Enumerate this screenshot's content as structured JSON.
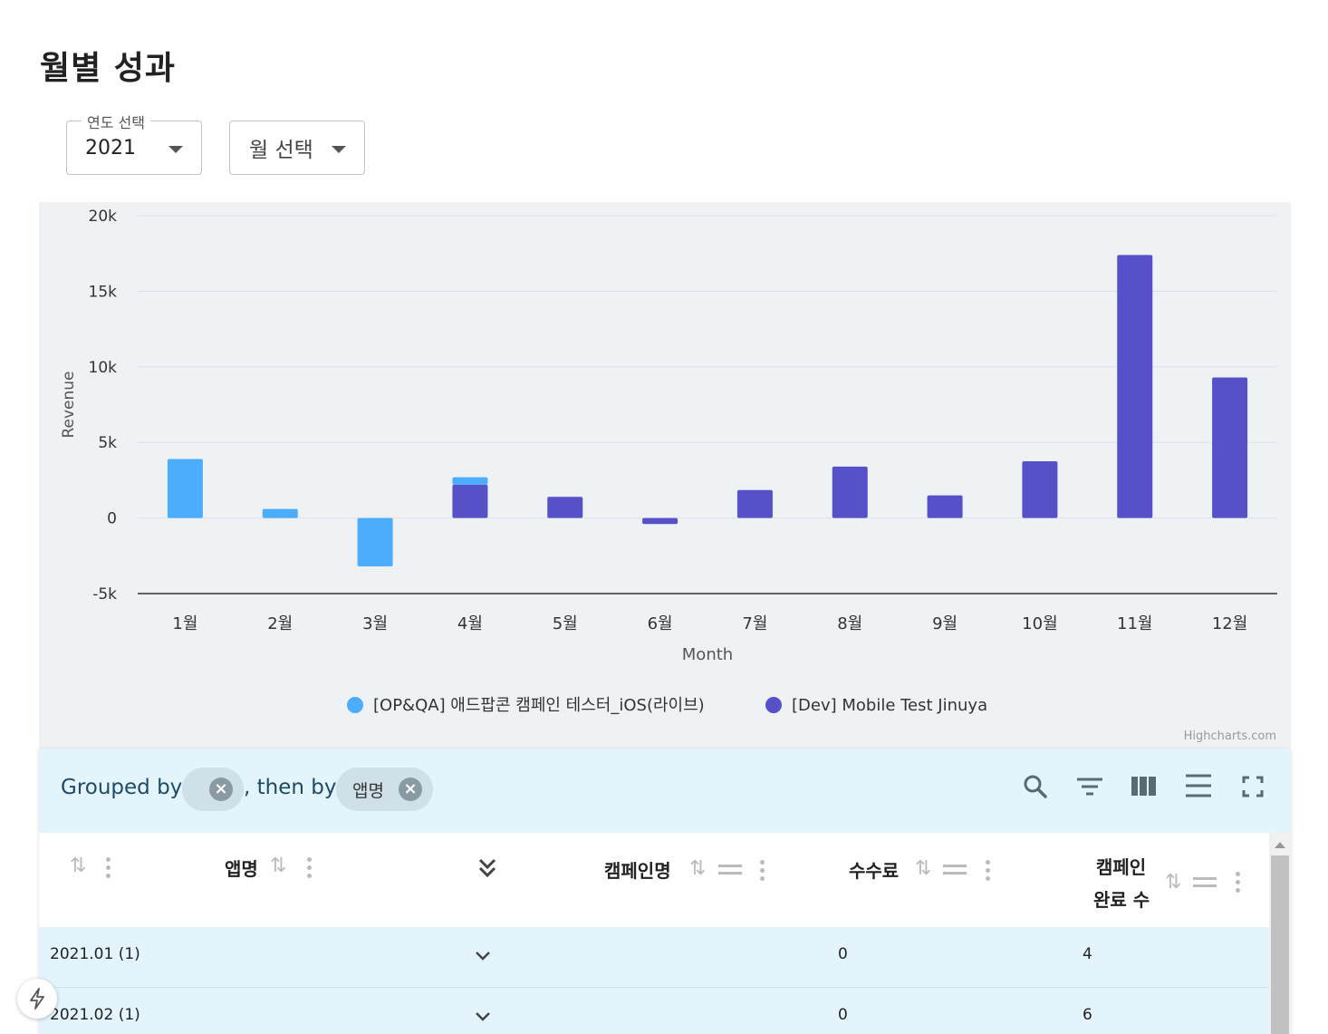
{
  "page": {
    "title": "월별 성과"
  },
  "filters": {
    "year": {
      "legend": "연도 선택",
      "value": "2021"
    },
    "month": {
      "value": "월 선택"
    }
  },
  "chart_data": {
    "type": "bar",
    "stacked": true,
    "categories": [
      "1월",
      "2월",
      "3월",
      "4월",
      "5월",
      "6월",
      "7월",
      "8월",
      "9월",
      "10월",
      "11월",
      "12월"
    ],
    "series": [
      {
        "name": "[OP&QA] 애드팝콘 캠페인 테스터_iOS(라이브)",
        "color": "#4badfc",
        "values": [
          3900,
          600,
          -3200,
          500,
          0,
          0,
          0,
          0,
          0,
          0,
          0,
          0
        ]
      },
      {
        "name": "[Dev] Mobile Test Jinuya",
        "color": "#5651c9",
        "values": [
          0,
          0,
          0,
          2200,
          1400,
          -400,
          1850,
          3400,
          1500,
          3750,
          17400,
          9300
        ]
      }
    ],
    "xlabel": "Month",
    "ylabel": "Revenue",
    "ylim": [
      -5000,
      20000
    ],
    "yticks": [
      "-5k",
      "0",
      "5k",
      "10k",
      "15k",
      "20k"
    ],
    "grid": true,
    "legend": "bottom-center",
    "credits": "Highcharts.com"
  },
  "grid": {
    "toolbar": {
      "grouped_by_label": "Grouped by",
      "then_by_label": ", then by",
      "chip_app": "앱명",
      "icons": [
        "search-icon",
        "filter-icon",
        "columns-icon",
        "density-icon",
        "fullscreen-icon"
      ]
    },
    "columns": {
      "app": "앱명",
      "campaign": "캠페인명",
      "fee": "수수료",
      "completed_line1": "캠페인",
      "completed_line2": "완료 수"
    },
    "rows": [
      {
        "group": "2021.01 (1)",
        "fee": "0",
        "completed": "4"
      },
      {
        "group": "2021.02 (1)",
        "fee": "0",
        "completed": "6"
      }
    ]
  },
  "colors": {
    "series_1": "#4badfc",
    "series_2": "#5651c9",
    "panel": "#e3f4fc",
    "chart_bg": "#eff2f5"
  }
}
